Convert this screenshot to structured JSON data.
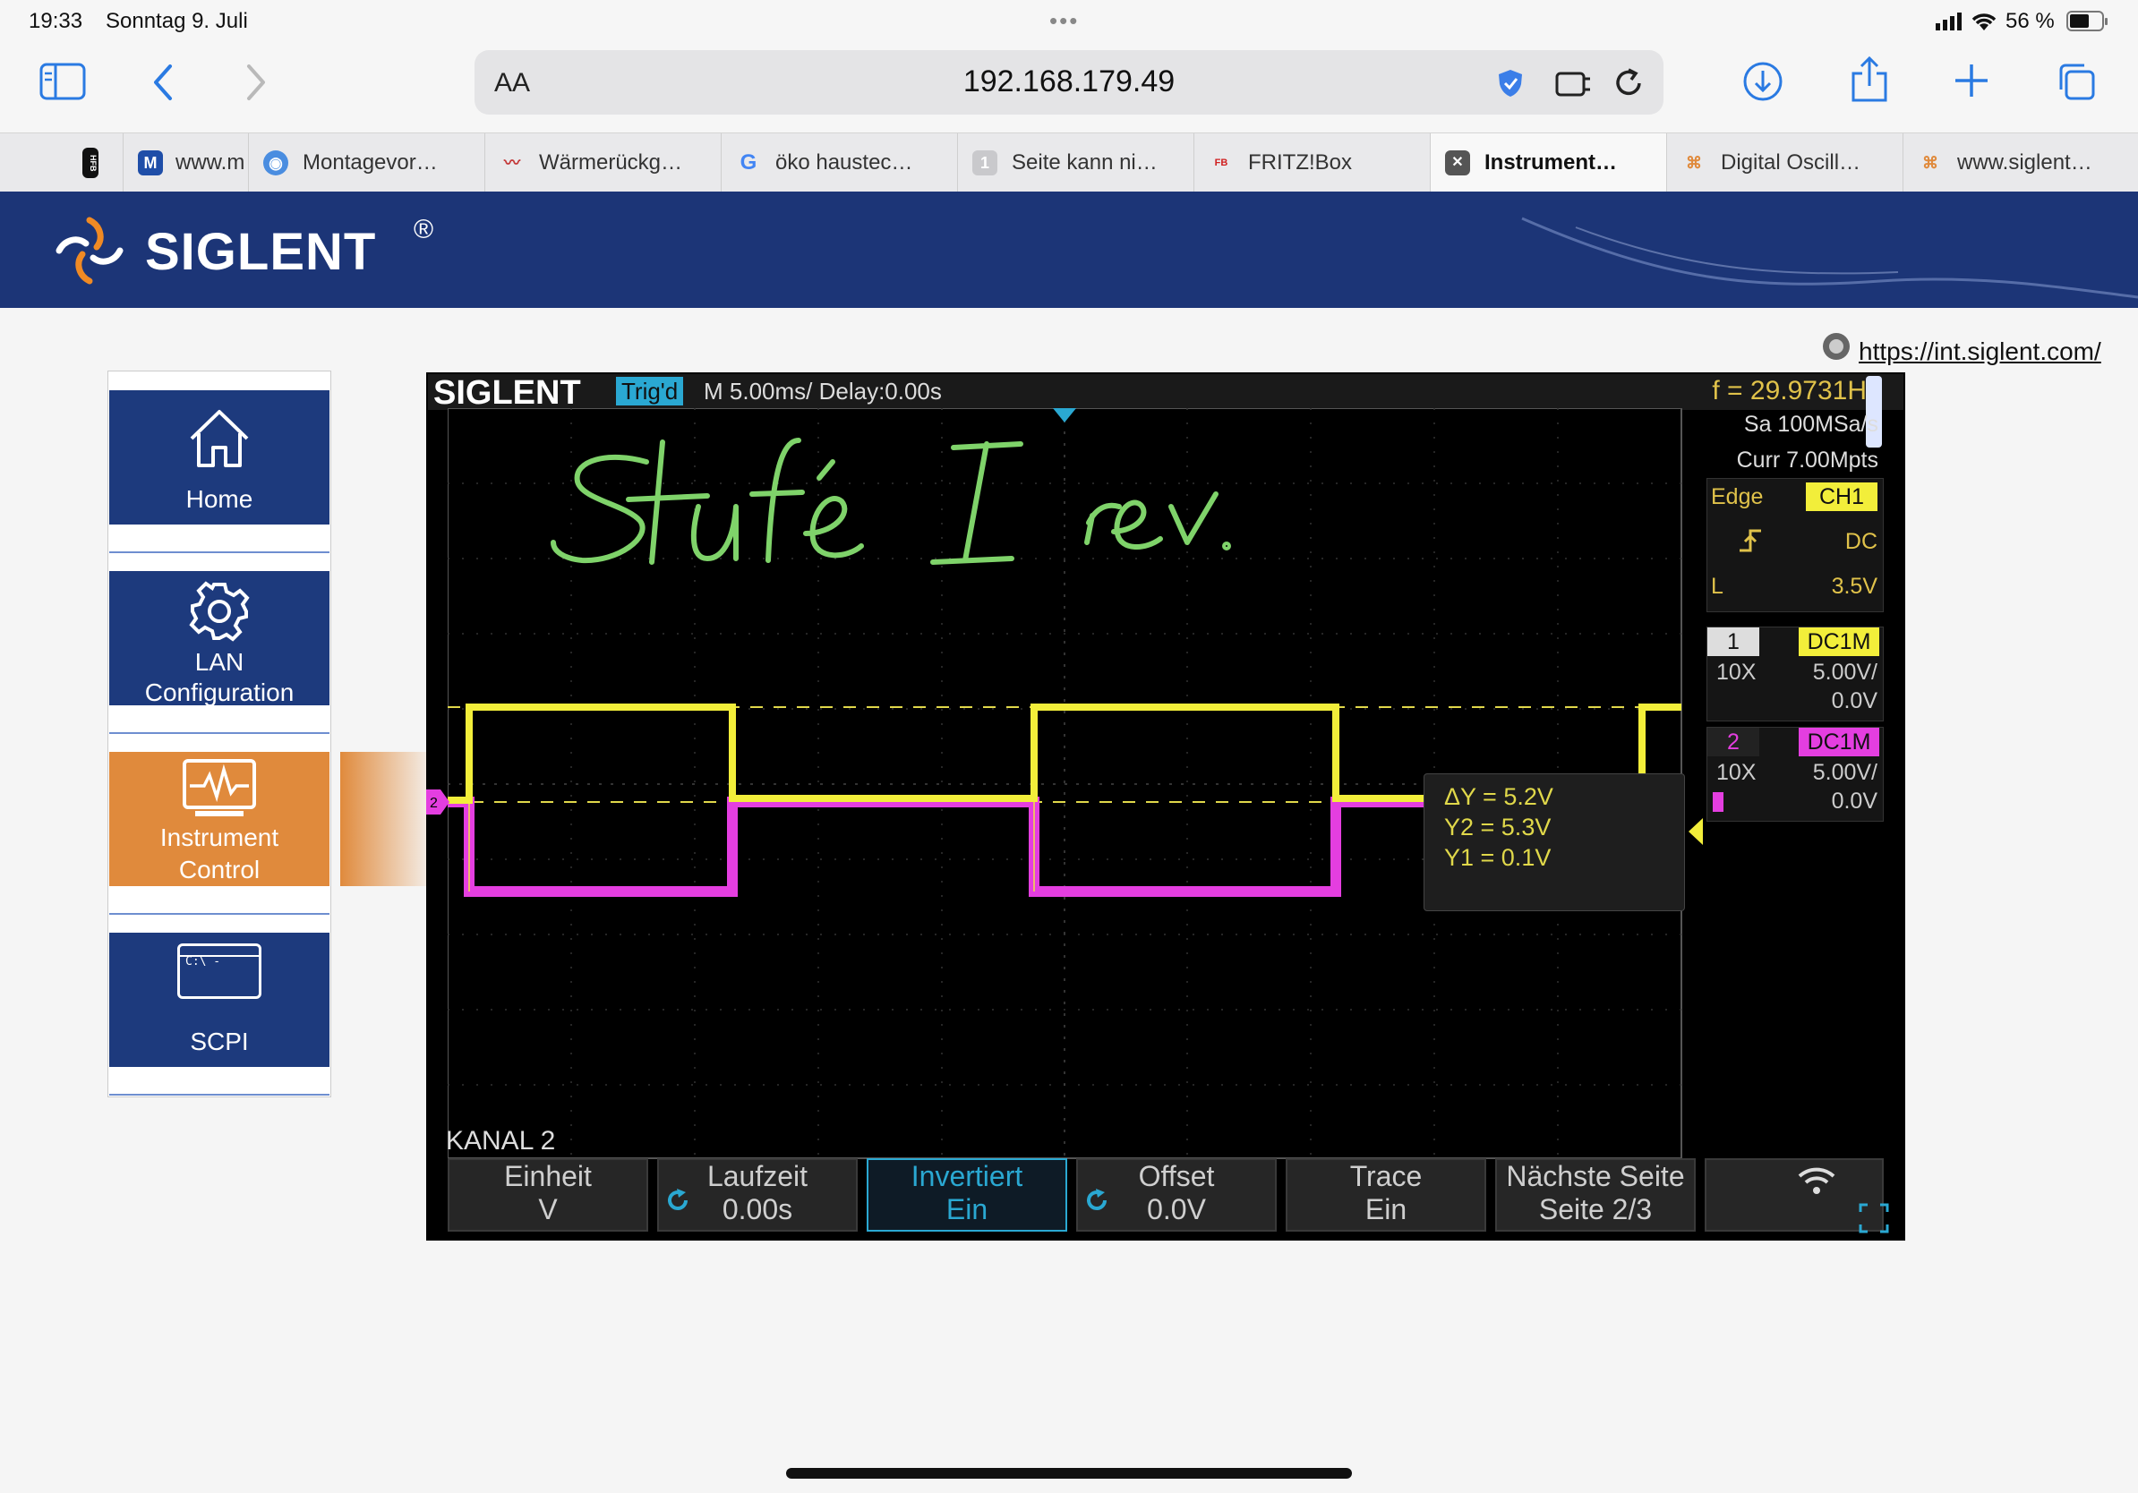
{
  "status": {
    "time": "19:33",
    "date": "Sonntag 9. Juli",
    "battery": "56 %"
  },
  "browser": {
    "text_size_label": "AA",
    "url": "192.168.179.49",
    "tabs": [
      {
        "favicon": "HFB",
        "title": ""
      },
      {
        "favicon": "M",
        "title": "www.m"
      },
      {
        "favicon": "◉",
        "title": "Montagevor…"
      },
      {
        "favicon": "〰",
        "title": "Wärmerückg…"
      },
      {
        "favicon": "G",
        "title": "öko haustec…"
      },
      {
        "favicon": "1",
        "title": "Seite kann ni…"
      },
      {
        "favicon": "FB",
        "title": "FRITZ!Box"
      },
      {
        "favicon": "✕",
        "title": "Instrument…"
      },
      {
        "favicon": "⌘",
        "title": "Digital Oscill…"
      },
      {
        "favicon": "⌘",
        "title": "www.siglent…"
      }
    ]
  },
  "site": {
    "brand": "SIGLENT",
    "registered": "®",
    "link": "https://int.siglent.com/",
    "menu": [
      {
        "label_line1": "Home",
        "label_line2": "",
        "icon": "home-icon"
      },
      {
        "label_line1": "LAN",
        "label_line2": "Configuration",
        "icon": "gear-icon"
      },
      {
        "label_line1": "Instrument",
        "label_line2": "Control",
        "icon": "monitor-pulse-icon"
      },
      {
        "label_line1": "",
        "label_line2": "SCPI",
        "icon": "terminal-icon"
      }
    ],
    "terminal_prompt": "C:\\ -"
  },
  "scope": {
    "logo": "SIGLENT",
    "trig_status": "Trig'd",
    "timebase": "M 5.00ms/ Delay:0.00s",
    "frequency": "f = 29.9731Hz",
    "sample_rate": "Sa 100MSa/s",
    "curr": "Curr 7.00Mpts",
    "trigger": {
      "type": "Edge",
      "source": "CH1",
      "coupling": "DC",
      "level_label": "L",
      "level": "3.5V"
    },
    "ch1": {
      "num": "1",
      "coupling": "DC1M",
      "probe": "10X",
      "scale": "5.00V/",
      "offset": "0.0V"
    },
    "ch2": {
      "num": "2",
      "coupling": "DC1M",
      "probe": "10X",
      "scale": "5.00V/",
      "offset": "0.0V"
    },
    "cursor": {
      "dy": "ΔY = 5.2V",
      "y2": "Y2 = 5.3V",
      "y1": "Y1 = 0.1V"
    },
    "annotation": "Stufe I rev.",
    "menu_title": "KANAL 2",
    "softkeys": [
      {
        "l1": "Einheit",
        "l2": "V"
      },
      {
        "l1": "Laufzeit",
        "l2": "0.00s"
      },
      {
        "l1": "Invertiert",
        "l2": "Ein"
      },
      {
        "l1": "Offset",
        "l2": "0.0V"
      },
      {
        "l1": "Trace",
        "l2": "Ein"
      },
      {
        "l1": "Nächste Seite",
        "l2": "Seite 2/3"
      }
    ],
    "colors": {
      "ch1": "#f2ee3a",
      "ch2": "#e43ee0",
      "accent": "#2aa8d2",
      "ink": "#7fd36a"
    }
  }
}
